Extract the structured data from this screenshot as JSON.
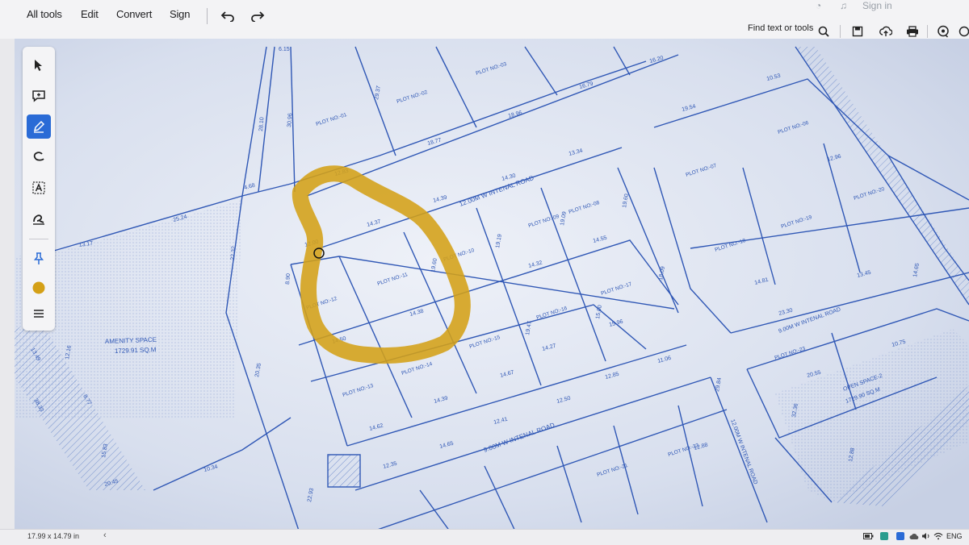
{
  "menu": {
    "all_tools": "All tools",
    "edit": "Edit",
    "convert": "Convert",
    "sign": "Sign"
  },
  "header_right": {
    "sign_in": "Sign in",
    "find": "Find text or tools"
  },
  "tools": [
    {
      "icon": "cursor-arrow-icon",
      "active": false
    },
    {
      "icon": "add-comment-icon",
      "active": false
    },
    {
      "icon": "highlight-pen-icon",
      "active": true
    },
    {
      "icon": "draw-freeform-icon",
      "active": false
    },
    {
      "icon": "text-select-icon",
      "active": false
    },
    {
      "icon": "stamp-signature-icon",
      "active": false
    },
    {
      "icon": "pin-icon",
      "active": false
    },
    {
      "icon": "color-swatch-icon",
      "active": false
    },
    {
      "icon": "menu-lines-icon",
      "active": false
    }
  ],
  "annotation_color": "#d4a017",
  "accent": "#2a6bd6",
  "map": {
    "roads": [
      "12.00M W INTENAL ROAD",
      "9.00M W INTENAL ROAD",
      "9.00M W INTENAL ROAD",
      "12.00M W INTENAL ROAD"
    ],
    "areas": {
      "amenity_title": "AMENITY SPACE",
      "amenity_value": "1729.91 SQ.M",
      "open_title": "OPEN SPACE-2",
      "open_value": "1729.90 SQ.M"
    },
    "plots": [
      "PLOT NO:-01",
      "PLOT NO:-02",
      "PLOT NO:-03",
      "PLOT NO:-06",
      "PLOT NO:-07",
      "PLOT NO:-08",
      "PLOT NO:-09",
      "PLOT NO:-10",
      "PLOT NO:-11",
      "PLOT NO:-12",
      "PLOT NO:-13",
      "PLOT NO:-14",
      "PLOT NO:-15",
      "PLOT NO:-16",
      "PLOT NO:-17",
      "PLOT NO:-18",
      "PLOT NO:-19",
      "PLOT NO:-20",
      "PLOT NO:-21",
      "PLOT NO:-22",
      "PLOT NO:-23"
    ],
    "dimensions": [
      "6.15",
      "28.10",
      "30.96",
      "29.37",
      "18.77",
      "18.96",
      "16.79",
      "16.20",
      "10.53",
      "19.54",
      "12.83",
      "13.34",
      "14.30",
      "14.39",
      "14.37",
      "19.60",
      "12.00",
      "19.19",
      "19.09",
      "14.55",
      "14.32",
      "19.60",
      "18.09",
      "15.00",
      "13.17",
      "25.24",
      "4.68",
      "22.32",
      "8.90",
      "19.47",
      "14.38",
      "14.50",
      "14.27",
      "14.67",
      "14.39",
      "15.96",
      "12.85",
      "11.06",
      "12.41",
      "12.50",
      "14.62",
      "14.65",
      "12.35",
      "12.88",
      "29.84",
      "20.35",
      "13.49",
      "38.33",
      "20.45",
      "12.16",
      "8.77",
      "10.34",
      "22.93",
      "15.83",
      "14.81",
      "20.55",
      "23.30",
      "10.75",
      "13.45",
      "14.65",
      "12.96",
      "32.36",
      "12.88"
    ]
  },
  "status": {
    "dimensions": "17.99 x 14.79 in",
    "lang": "ENG"
  }
}
